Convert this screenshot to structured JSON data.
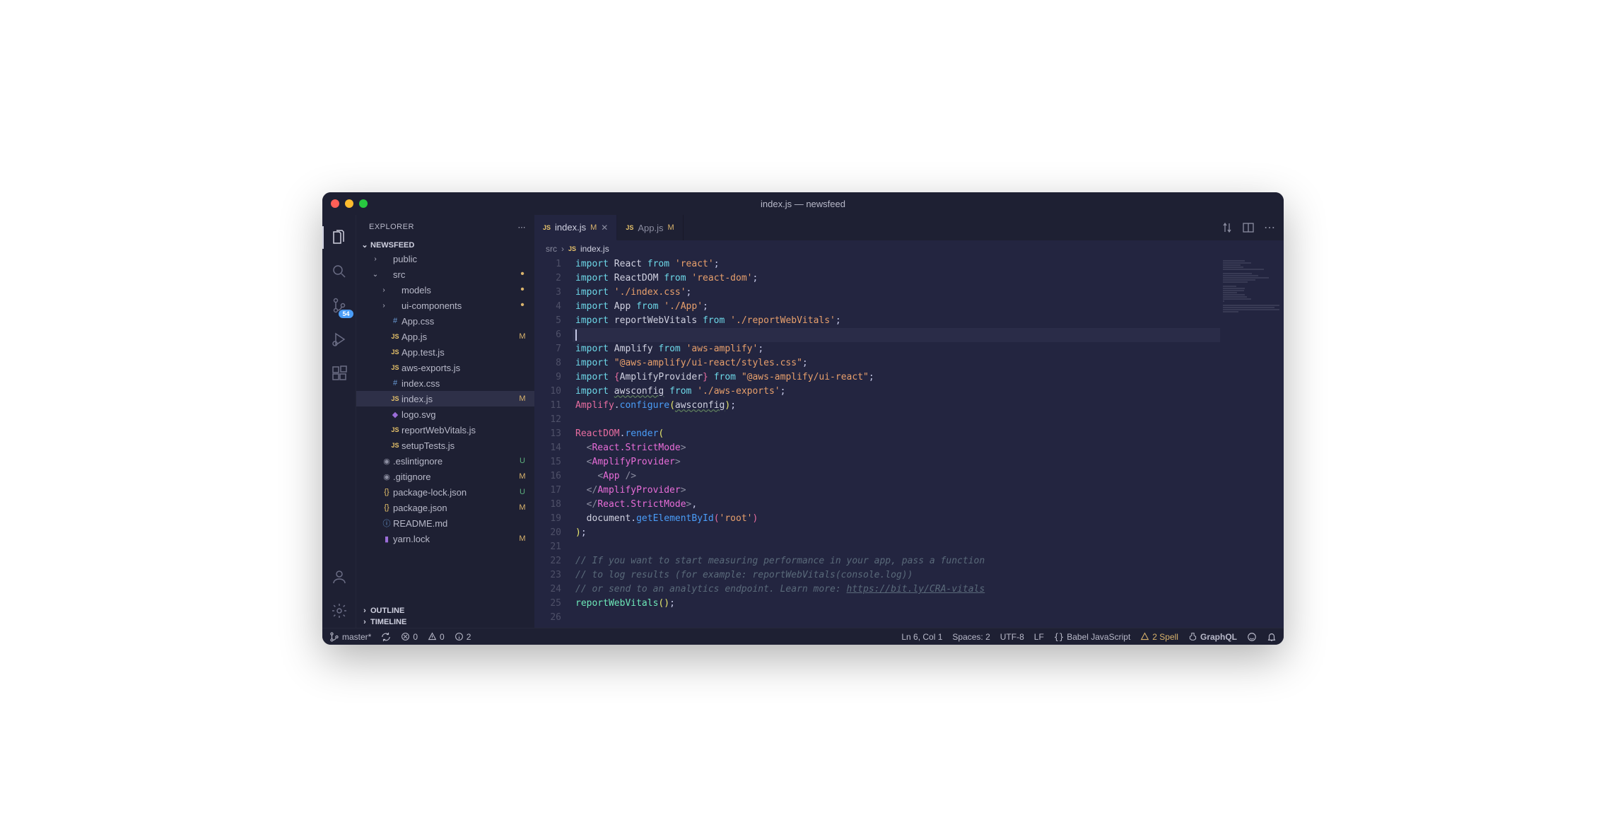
{
  "window_title": "index.js — newsfeed",
  "explorer_label": "EXPLORER",
  "project_name": "NEWSFEED",
  "outline_label": "OUTLINE",
  "timeline_label": "TIMELINE",
  "scm_badge": "54",
  "tabs": [
    {
      "icon": "JS",
      "name": "index.js",
      "modified": "M",
      "active": true,
      "close": true
    },
    {
      "icon": "JS",
      "name": "App.js",
      "modified": "M",
      "active": false,
      "close": false
    }
  ],
  "breadcrumb": {
    "parts": [
      "src",
      "index.js"
    ]
  },
  "tree": [
    {
      "depth": 1,
      "folder": true,
      "open": false,
      "name": "public",
      "status": ""
    },
    {
      "depth": 1,
      "folder": true,
      "open": true,
      "name": "src",
      "status": "dot"
    },
    {
      "depth": 2,
      "folder": true,
      "open": false,
      "name": "models",
      "status": "dot"
    },
    {
      "depth": 2,
      "folder": true,
      "open": false,
      "name": "ui-components",
      "status": "dot"
    },
    {
      "depth": 2,
      "icon": "css",
      "name": "App.css",
      "status": ""
    },
    {
      "depth": 2,
      "icon": "js",
      "name": "App.js",
      "status": "M"
    },
    {
      "depth": 2,
      "icon": "js",
      "name": "App.test.js",
      "status": ""
    },
    {
      "depth": 2,
      "icon": "js",
      "name": "aws-exports.js",
      "status": ""
    },
    {
      "depth": 2,
      "icon": "css",
      "name": "index.css",
      "status": ""
    },
    {
      "depth": 2,
      "icon": "js",
      "name": "index.js",
      "status": "M",
      "selected": true
    },
    {
      "depth": 2,
      "icon": "svg",
      "name": "logo.svg",
      "status": ""
    },
    {
      "depth": 2,
      "icon": "js",
      "name": "reportWebVitals.js",
      "status": ""
    },
    {
      "depth": 2,
      "icon": "js",
      "name": "setupTests.js",
      "status": ""
    },
    {
      "depth": 1,
      "icon": "info",
      "name": ".eslintignore",
      "status": "U"
    },
    {
      "depth": 1,
      "icon": "info",
      "name": ".gitignore",
      "status": "M"
    },
    {
      "depth": 1,
      "icon": "json",
      "name": "package-lock.json",
      "status": "U"
    },
    {
      "depth": 1,
      "icon": "json",
      "name": "package.json",
      "status": "M"
    },
    {
      "depth": 1,
      "icon": "md",
      "name": "README.md",
      "status": ""
    },
    {
      "depth": 1,
      "icon": "lock",
      "name": "yarn.lock",
      "status": "M"
    }
  ],
  "code_lines": [
    {
      "n": 1,
      "html": "<span class='tok-kw'>import</span> <span class='tok-def'>React</span> <span class='tok-kw'>from</span> <span class='tok-str'>'react'</span>;"
    },
    {
      "n": 2,
      "html": "<span class='tok-kw'>import</span> <span class='tok-def'>ReactDOM</span> <span class='tok-kw'>from</span> <span class='tok-str'>'react-dom'</span>;"
    },
    {
      "n": 3,
      "html": "<span class='tok-kw'>import</span> <span class='tok-str'>'./index.css'</span>;"
    },
    {
      "n": 4,
      "html": "<span class='tok-kw'>import</span> <span class='tok-def'>App</span> <span class='tok-kw'>from</span> <span class='tok-str'>'./App'</span>;"
    },
    {
      "n": 5,
      "html": "<span class='tok-kw'>import</span> <span class='tok-def'>reportWebVitals</span> <span class='tok-kw'>from</span> <span class='tok-str'>'./reportWebVitals'</span>;"
    },
    {
      "n": 6,
      "html": "",
      "hl": true,
      "cursor": true
    },
    {
      "n": 7,
      "html": "<span class='tok-kw'>import</span> <span class='tok-def'>Amplify</span> <span class='tok-kw'>from</span> <span class='tok-str'>'aws-amplify'</span>;"
    },
    {
      "n": 8,
      "html": "<span class='tok-kw'>import</span> <span class='tok-str'>\"@aws-amplify/ui-react/styles.css\"</span>;"
    },
    {
      "n": 9,
      "html": "<span class='tok-kw'>import</span> <span class='tok-pink'>{</span><span class='tok-def'>AmplifyProvider</span><span class='tok-pink'>}</span> <span class='tok-kw'>from</span> <span class='tok-str'>\"@aws-amplify/ui-react\"</span>;"
    },
    {
      "n": 10,
      "html": "<span class='tok-kw'>import</span> <span class='tok-def tok-underline'>awsconfig</span> <span class='tok-kw'>from</span> <span class='tok-str'>'./aws-exports'</span>;"
    },
    {
      "n": 11,
      "html": "<span class='tok-pink'>Amplify</span>.<span class='tok-fn2'>configure</span><span class='tok-cmp'>(</span><span class='tok-def tok-underline'>awsconfig</span><span class='tok-cmp'>)</span>;"
    },
    {
      "n": 12,
      "html": ""
    },
    {
      "n": 13,
      "html": "<span class='tok-pink'>ReactDOM</span>.<span class='tok-fn2'>render</span><span class='tok-cmp'>(</span>"
    },
    {
      "n": 14,
      "html": "  <span class='tok-punct'>&lt;</span><span class='tok-tag'>React.StrictMode</span><span class='tok-punct'>&gt;</span>"
    },
    {
      "n": 15,
      "html": "  <span class='tok-punct'>&lt;</span><span class='tok-tag'>AmplifyProvider</span><span class='tok-punct'>&gt;</span>"
    },
    {
      "n": 16,
      "html": "    <span class='tok-punct'>&lt;</span><span class='tok-tag'>App</span> <span class='tok-punct'>/&gt;</span>"
    },
    {
      "n": 17,
      "html": "  <span class='tok-punct'>&lt;/</span><span class='tok-tag'>AmplifyProvider</span><span class='tok-punct'>&gt;</span>"
    },
    {
      "n": 18,
      "html": "  <span class='tok-punct'>&lt;/</span><span class='tok-tag'>React.StrictMode</span><span class='tok-punct'>&gt;</span>,"
    },
    {
      "n": 19,
      "html": "  <span class='tok-def'>document</span>.<span class='tok-fn2'>getElementById</span><span class='tok-pink'>(</span><span class='tok-str'>'root'</span><span class='tok-pink'>)</span>"
    },
    {
      "n": 20,
      "html": "<span class='tok-cmp'>)</span>;"
    },
    {
      "n": 21,
      "html": ""
    },
    {
      "n": 22,
      "html": "<span class='tok-comment'>// If you want to start measuring performance in your app, pass a function</span>"
    },
    {
      "n": 23,
      "html": "<span class='tok-comment'>// to log results (for example: reportWebVitals(console.log))</span>"
    },
    {
      "n": 24,
      "html": "<span class='tok-comment'>// or send to an analytics endpoint. Learn more: </span><span class='tok-link'>https://bit.ly/CRA-vitals</span>"
    },
    {
      "n": 25,
      "html": "<span class='tok-fn'>reportWebVitals</span><span class='tok-cmp'>()</span>;"
    },
    {
      "n": 26,
      "html": ""
    }
  ],
  "statusbar": {
    "branch": "master*",
    "errors": "0",
    "warnings": "0",
    "info": "2",
    "position": "Ln 6, Col 1",
    "spaces": "Spaces: 2",
    "encoding": "UTF-8",
    "eol": "LF",
    "language": "Babel JavaScript",
    "spell": "2 Spell",
    "graphql": "GraphQL"
  }
}
